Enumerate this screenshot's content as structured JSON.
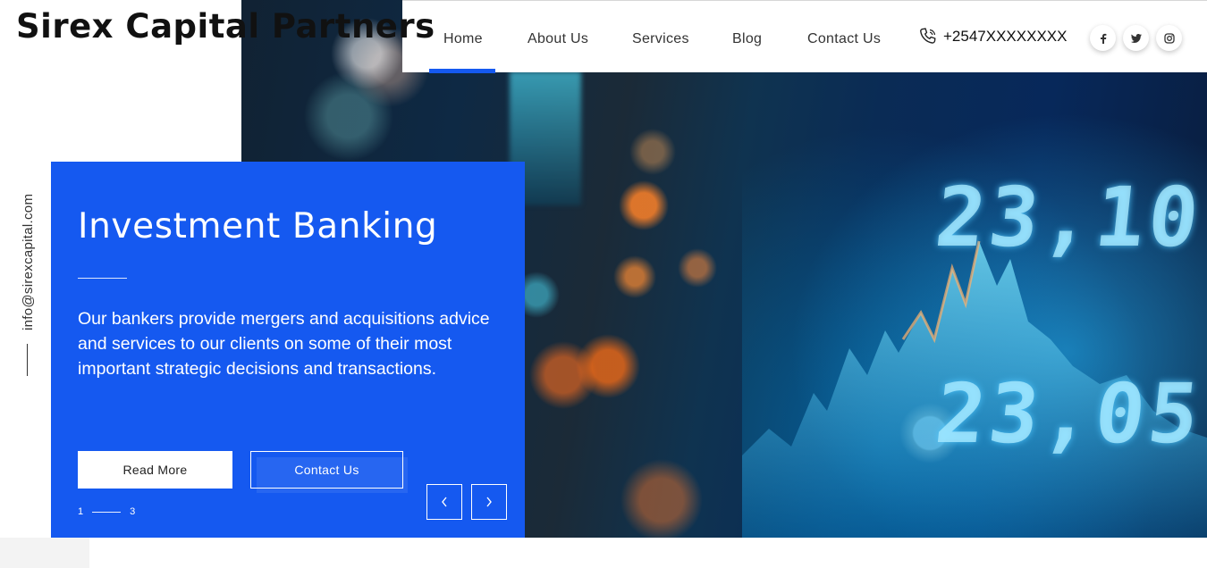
{
  "brand": {
    "logo_text": "Sirex Capital Partners"
  },
  "nav": {
    "items": [
      {
        "label": "Home",
        "active": true
      },
      {
        "label": "About Us"
      },
      {
        "label": "Services"
      },
      {
        "label": "Blog"
      },
      {
        "label": "Contact Us"
      }
    ],
    "phone": {
      "icon": "phone-icon",
      "number": "+2547XXXXXXXX"
    },
    "socials": [
      {
        "icon": "facebook-icon",
        "glyph": "f"
      },
      {
        "icon": "twitter-icon",
        "glyph": "t"
      },
      {
        "icon": "instagram-icon",
        "glyph": "ig"
      }
    ]
  },
  "side": {
    "email": "info@sirexcapital.com"
  },
  "hero": {
    "title": "Investment Banking",
    "description": "Our bankers provide mergers and acquisitions advice and services to our clients on some of their most important strategic decisions and transactions.",
    "primary_button": "Read More",
    "secondary_button": "Contact Us",
    "pager": {
      "current": "1",
      "total": "3"
    },
    "background_digits": [
      "23,10",
      "23,05"
    ],
    "prev_icon": "chevron-left-icon",
    "next_icon": "chevron-right-icon"
  },
  "colors": {
    "accent": "#1559f0",
    "card_bg": "#1559f0",
    "nav_bg": "#ffffff"
  }
}
